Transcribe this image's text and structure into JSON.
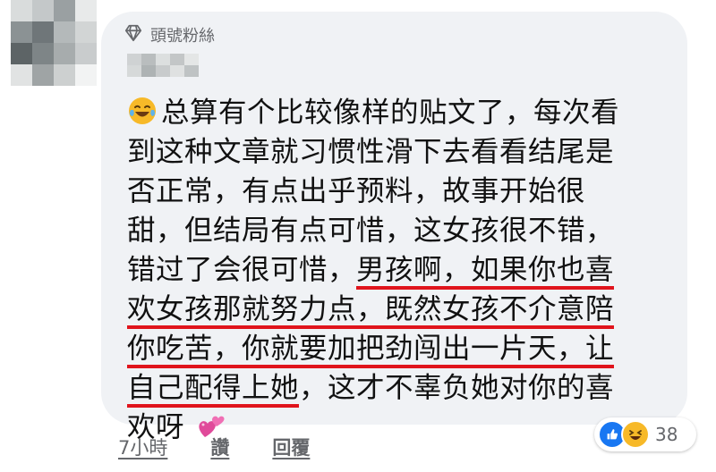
{
  "comment": {
    "badge_label": "頭號粉絲",
    "lines": [
      {
        "before": "总算有个比较像样的贴文了，每次看",
        "hl": "",
        "after": ""
      },
      {
        "before": "到这种文章就习惯性滑下去看看结尾是",
        "hl": "",
        "after": ""
      },
      {
        "before": "否正常，有点出乎预料，故事开始很",
        "hl": "",
        "after": ""
      },
      {
        "before": "甜，但结局有点可惜，这女孩很不错，",
        "hl": "",
        "after": ""
      },
      {
        "before": "错过了会很可惜，",
        "hl": "男孩啊，如果你也喜",
        "after": ""
      },
      {
        "before": "",
        "hl": "欢女孩那就努力点，既然女孩不介意陪",
        "after": ""
      },
      {
        "before": "",
        "hl": "你吃苦，你就要加把劲闯出一片天，让",
        "after": ""
      },
      {
        "before": "",
        "hl": "自己配得上她",
        "after": "，这才不辜负她对你的喜"
      },
      {
        "before": "欢呀",
        "hl": "",
        "after": ""
      }
    ],
    "highlight_color": "#e0141c"
  },
  "actions": {
    "time": "7小時",
    "like_label": "讚",
    "reply_label": "回覆"
  },
  "reactions": {
    "icons": [
      "like-icon",
      "haha-icon"
    ],
    "count": "38"
  },
  "colors": {
    "bubble": "#f0f2f5",
    "like_blue": "#1877f2",
    "haha_yellow": "#f7b928"
  }
}
